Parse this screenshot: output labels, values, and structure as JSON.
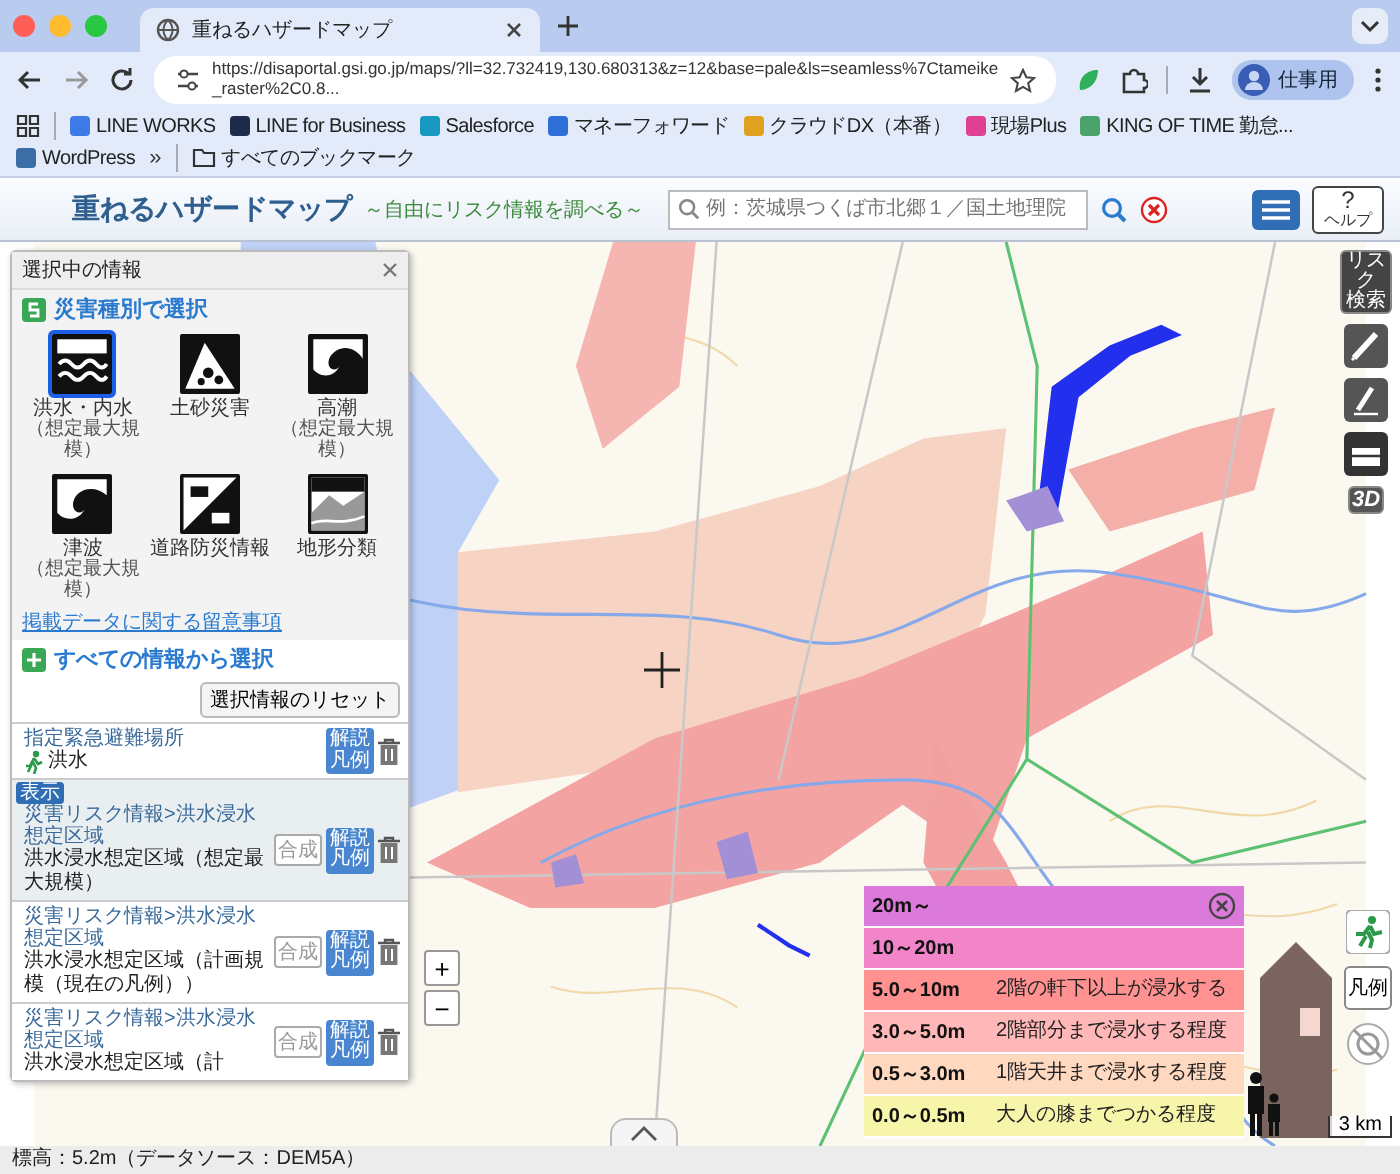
{
  "browser": {
    "tab_title": "重ねるハザードマップ",
    "url": "https://disaportal.gsi.go.jp/maps/?ll=32.732419,130.680313&z=12&base=pale&ls=seamless%7Ctameike_raster%2C0.8...",
    "profile": "仕事用",
    "bookmarks": [
      {
        "label": "LINE WORKS",
        "color": "#3f7be6"
      },
      {
        "label": "LINE for Business",
        "color": "#1d2a48"
      },
      {
        "label": "Salesforce",
        "color": "#1798c1"
      },
      {
        "label": "マネーフォワード",
        "color": "#2d6fd6"
      },
      {
        "label": "クラウドDX（本番）",
        "color": "#e0a020"
      },
      {
        "label": "現場Plus",
        "color": "#e04090"
      },
      {
        "label": "KING OF TIME 勤怠...",
        "color": "#49a36a"
      },
      {
        "label": "WordPress",
        "color": "#3a6ea5"
      }
    ],
    "more": "»",
    "all_bookmarks": "すべてのブックマーク"
  },
  "app": {
    "title": "重ねるハザードマップ",
    "subtitle": "～自由にリスク情報を調べる～",
    "search_placeholder": "例：茨城県つくば市北郷１／国土地理院",
    "help_mark": "?",
    "help": "ヘルプ"
  },
  "panel": {
    "title": "選択中の情報",
    "by_type": "災害種別で選択",
    "hazards": [
      {
        "kind": "flood",
        "label": "洪水・内水",
        "note": "（想定最大規模）",
        "selected": true
      },
      {
        "kind": "landslide",
        "label": "土砂災害",
        "selected": false
      },
      {
        "kind": "storm_surge",
        "label": "高潮",
        "note": "（想定最大規模）",
        "selected": false
      },
      {
        "kind": "tsunami",
        "label": "津波",
        "note": "（想定最大規模）",
        "selected": false
      },
      {
        "kind": "road",
        "label": "道路防災情報",
        "selected": false
      },
      {
        "kind": "terrain",
        "label": "地形分類",
        "selected": false
      }
    ],
    "notice_link": "掲載データに関する留意事項",
    "all_info": "すべての情報から選択",
    "reset": "選択情報のリセット",
    "layers": [
      {
        "kind": "shelter",
        "category": "指定緊急避難場所",
        "name": "洪水",
        "explain": [
          "解説",
          "凡例"
        ],
        "selected": false
      },
      {
        "kind": "area",
        "badge": "表示",
        "category": "災害リスク情報>洪水浸水想定区域",
        "name": "洪水浸水想定区域（想定最大規模）",
        "compose": "合成",
        "explain": [
          "解説",
          "凡例"
        ],
        "selected": true
      },
      {
        "kind": "area",
        "category": "災害リスク情報>洪水浸水想定区域",
        "name": "洪水浸水想定区域（計画規模（現在の凡例））",
        "compose": "合成",
        "explain": [
          "解説",
          "凡例"
        ],
        "selected": false
      },
      {
        "kind": "area",
        "category": "災害リスク情報>洪水浸水想定区域",
        "name": "洪水浸水想定区域（計",
        "compose": "合成",
        "explain": [
          "解説",
          "凡例"
        ],
        "selected": false
      }
    ]
  },
  "tools": {
    "risk_search": [
      "リスク",
      "検索"
    ],
    "three_d": "3D",
    "legend_button": "凡例"
  },
  "zoom": {
    "in": "+",
    "out": "−"
  },
  "legend": {
    "rows": [
      {
        "range": "20m～",
        "color": "#dc7adc"
      },
      {
        "range": "10～20m",
        "color": "#f285c9"
      },
      {
        "range": "5.0～10m",
        "note": "2階の軒下以上が浸水する",
        "color": "#ff9191"
      },
      {
        "range": "3.0～5.0m",
        "note": "2階部分まで浸水する程度",
        "color": "#ffb7b7"
      },
      {
        "range": "0.5～3.0m",
        "note": "1階天井まで浸水する程度",
        "color": "#ffd8c0"
      },
      {
        "range": "0.0～0.5m",
        "note": "大人の膝までつかる程度",
        "color": "#f7f5a9"
      }
    ],
    "scale": "3 km"
  },
  "status": "標高：5.2m（データソース：DEM5A）"
}
